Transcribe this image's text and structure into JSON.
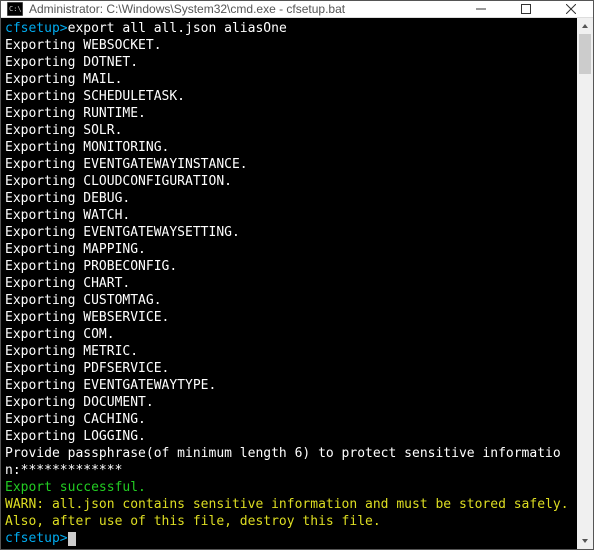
{
  "window": {
    "title": "Administrator: C:\\Windows\\System32\\cmd.exe - cfsetup.bat"
  },
  "prompt1": "cfsetup>",
  "command1": "export all all.json aliasOne",
  "lines": [
    "Exporting WEBSOCKET.",
    "Exporting DOTNET.",
    "Exporting MAIL.",
    "Exporting SCHEDULETASK.",
    "Exporting RUNTIME.",
    "Exporting SOLR.",
    "Exporting MONITORING.",
    "Exporting EVENTGATEWAYINSTANCE.",
    "Exporting CLOUDCONFIGURATION.",
    "Exporting DEBUG.",
    "Exporting WATCH.",
    "Exporting EVENTGATEWAYSETTING.",
    "Exporting MAPPING.",
    "Exporting PROBECONFIG.",
    "Exporting CHART.",
    "Exporting CUSTOMTAG.",
    "Exporting WEBSERVICE.",
    "Exporting COM.",
    "Exporting METRIC.",
    "Exporting PDFSERVICE.",
    "Exporting EVENTGATEWAYTYPE.",
    "Exporting DOCUMENT.",
    "Exporting CACHING.",
    "Exporting LOGGING."
  ],
  "passphrase_line": "Provide passphrase(of minimum length 6) to protect sensitive information:*************",
  "success_line": "Export successful.",
  "warn_line": "WARN: all.json contains sensitive information and must be stored safely. Also, after use of this file, destroy this file.",
  "prompt2": "cfsetup>"
}
